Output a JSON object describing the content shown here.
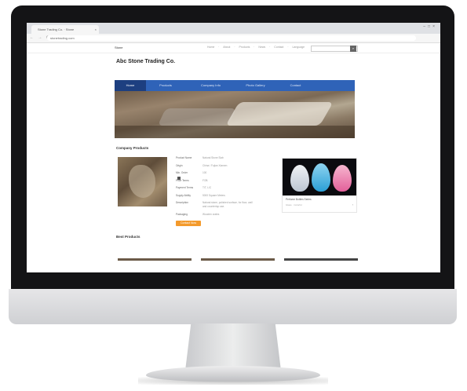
{
  "browser": {
    "tab_title": "Stone Trading Co. · Stone",
    "tab_close": "×",
    "window_controls": "–□×",
    "nav_buttons": "← → ⟳",
    "url": "stonetrading.com"
  },
  "site": {
    "logo": "Stone",
    "top_links": "Home · About · Products · News · Contact · Language",
    "search_icon": "search-icon",
    "search_btn_label": "⌕",
    "company_name": "Abc Stone Trading Co.",
    "nav": [
      {
        "label": "Home"
      },
      {
        "label": "Products"
      },
      {
        "label": "Company Info"
      },
      {
        "label": "Photo Gallery"
      },
      {
        "label": "Contact"
      }
    ],
    "section_product": "Company Products",
    "section_best": "Best Products",
    "specs": [
      {
        "label": "Product Name",
        "value": "Natural Stone Slab"
      },
      {
        "label": "Origin",
        "value": "China / Fujian Xiamen"
      },
      {
        "label": "Min. Order",
        "value": "100"
      },
      {
        "label": "Price Terms",
        "value": "FOB"
      },
      {
        "label": "Payment Terms",
        "value": "T/T, L/C"
      },
      {
        "label": "Supply Ability",
        "value": "5000 Square Meters"
      },
      {
        "label": "Description",
        "value": "Natural stone, polished surface, for floor, wall"
      },
      {
        "label": "",
        "value": "and countertop use."
      },
      {
        "label": "Packaging",
        "value": "Wooden crates"
      }
    ],
    "contact_button": "Contact Now",
    "side_card": {
      "caption": "Perfume Bottles Series",
      "sub": "Glass · Colorful",
      "arrow": "›"
    }
  }
}
